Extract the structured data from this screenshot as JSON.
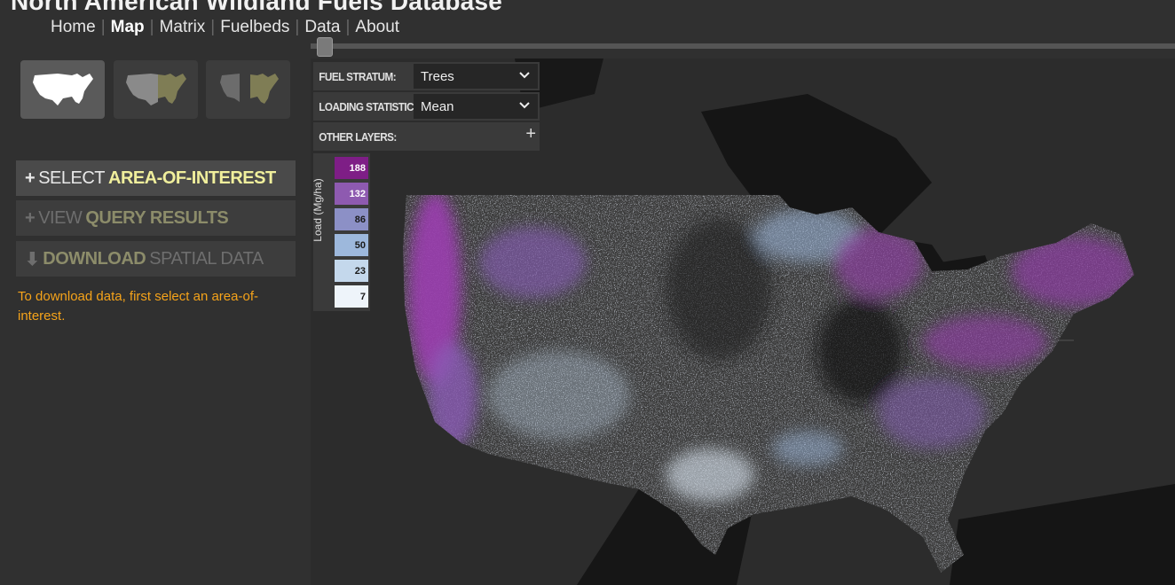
{
  "header": {
    "title": "North American Wildland Fuels Database",
    "nav": [
      {
        "label": "Home",
        "active": false
      },
      {
        "label": "Map",
        "active": true
      },
      {
        "label": "Matrix",
        "active": false
      },
      {
        "label": "Fuelbeds",
        "active": false
      },
      {
        "label": "Data",
        "active": false
      },
      {
        "label": "About",
        "active": false
      }
    ]
  },
  "sidebar": {
    "mode_buttons": [
      {
        "icon": "us-map-icon",
        "selected": true
      },
      {
        "icon": "us-map-split-east-icon",
        "selected": false
      },
      {
        "icon": "us-map-split-west-icon",
        "selected": false
      }
    ],
    "select_aoi": {
      "prefix": "SELECT",
      "highlight": "AREA-OF-INTEREST"
    },
    "view_results": {
      "prefix": "VIEW",
      "highlight": "QUERY RESULTS"
    },
    "download": {
      "highlight": "DOWNLOAD",
      "suffix": "SPATIAL DATA"
    },
    "note": "To download data, first select an area-of-interest."
  },
  "controls": {
    "fuel_stratum": {
      "label": "FUEL STRATUM:",
      "value": "Trees"
    },
    "loading_statistic": {
      "label": "LOADING STATISTIC:",
      "value": "Mean"
    },
    "other_layers": {
      "label": "OTHER LAYERS:",
      "icon": "plus-icon"
    }
  },
  "legend": {
    "title": "Load (Mg/ha)",
    "entries": [
      {
        "value": "188",
        "color": "#7e1e86",
        "text_color": "#ffffff"
      },
      {
        "value": "132",
        "color": "#8e5ab0",
        "text_color": "#ffffff"
      },
      {
        "value": "86",
        "color": "#8c90c6",
        "text_color": "#1a1a1a"
      },
      {
        "value": "50",
        "color": "#9db8dc",
        "text_color": "#1a1a1a"
      },
      {
        "value": "23",
        "color": "#c4d8ec",
        "text_color": "#1a1a1a"
      },
      {
        "value": "7",
        "color": "#eef4fa",
        "text_color": "#1a1a1a"
      }
    ]
  },
  "colors": {
    "accent_note": "#f5a31a",
    "highlight": "#f0ef9c",
    "map_land": "#3c3c3c",
    "map_water": "#151515"
  }
}
